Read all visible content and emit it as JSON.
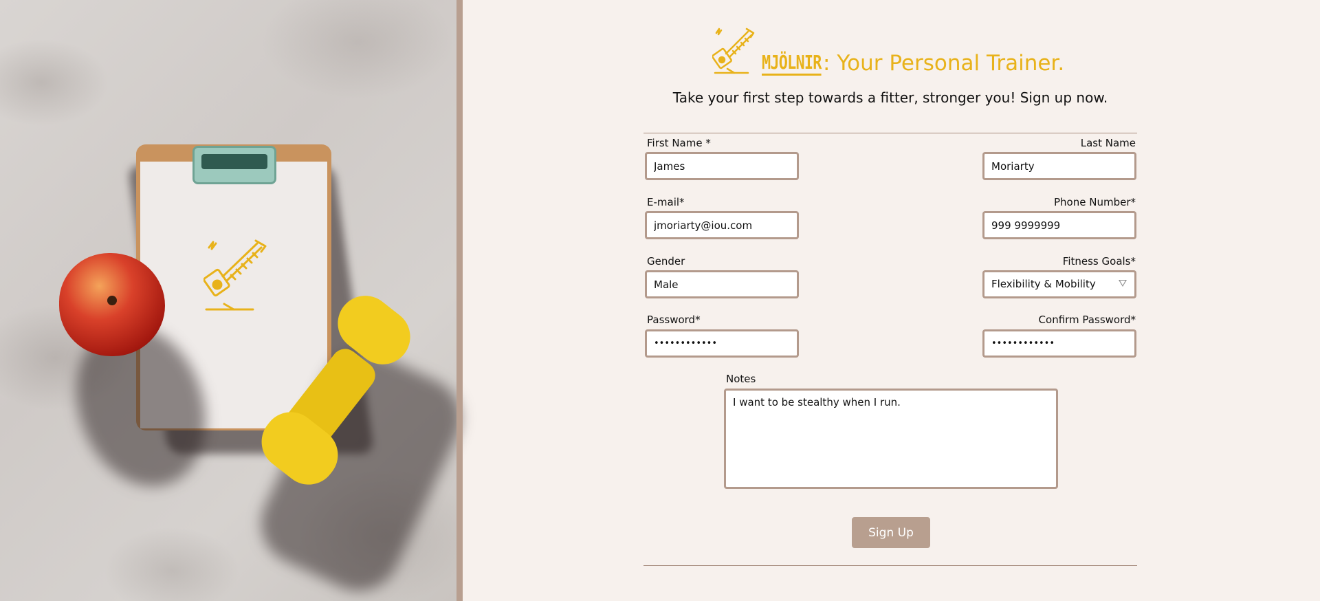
{
  "brand": {
    "logo_word": "MJÖLNIR",
    "title_rest": ": Your Personal Trainer.",
    "accent_color": "#e8b21a",
    "logo_icon": "hammer-icon"
  },
  "tagline": "Take your first step towards a fitter, stronger you! Sign up now.",
  "form": {
    "first_name": {
      "label": "First Name *",
      "value": "James"
    },
    "last_name": {
      "label": "Last Name",
      "value": "Moriarty"
    },
    "email": {
      "label": "E-mail*",
      "value": "jmoriarty@iou.com"
    },
    "phone": {
      "label": "Phone Number*",
      "value": "999 9999999"
    },
    "gender": {
      "label": "Gender",
      "value": "Male"
    },
    "fitness_goals": {
      "label": "Fitness Goals*",
      "value": "Flexibility & Mobility"
    },
    "password": {
      "label": "Password*",
      "value": "••••••••••••"
    },
    "confirm_password": {
      "label": "Confirm Password*",
      "value": "••••••••••••"
    },
    "notes": {
      "label": "Notes",
      "value": "I want to be stealthy when I run."
    },
    "submit_label": "Sign Up"
  },
  "colors": {
    "page_bg": "#f7f1ed",
    "field_border": "#b39a8c",
    "button_bg": "#b89f8f"
  }
}
